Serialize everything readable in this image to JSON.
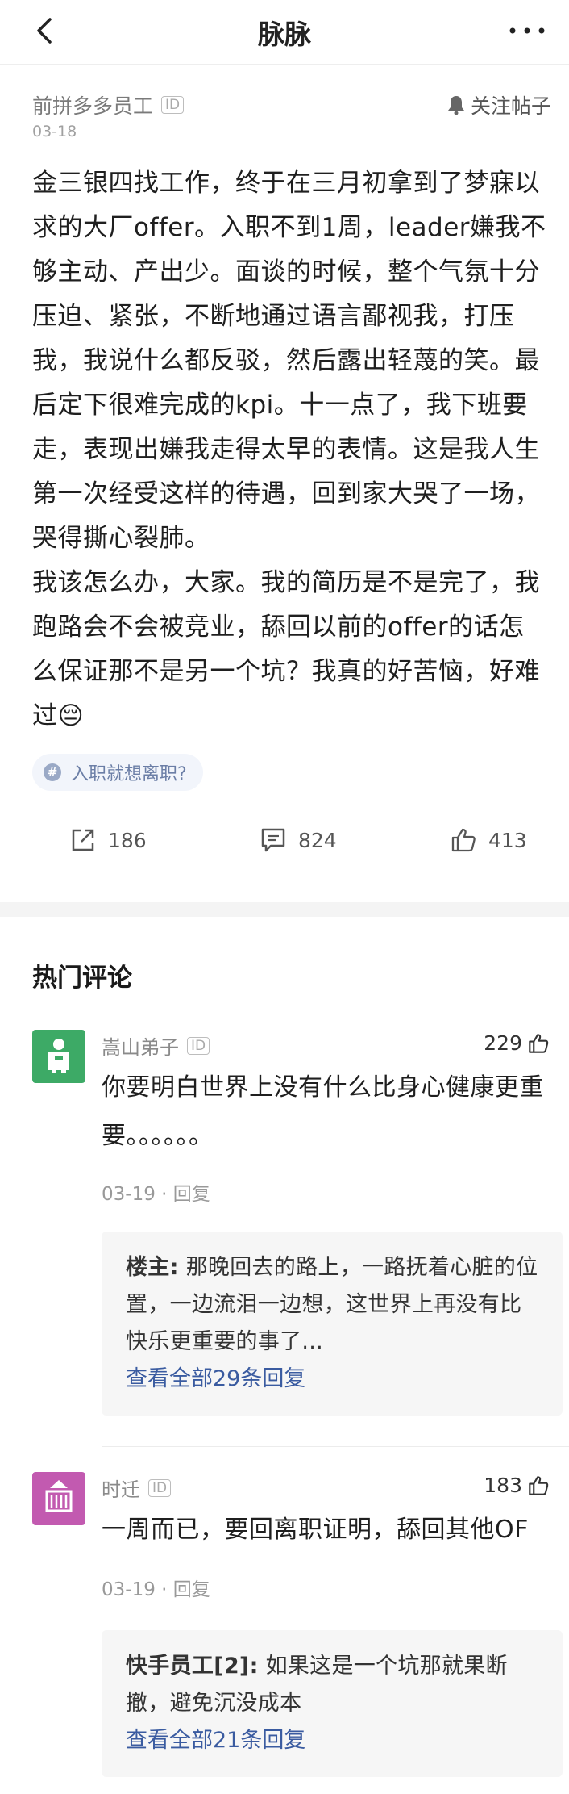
{
  "nav": {
    "title": "脉脉"
  },
  "post": {
    "author": "前拼多多员工",
    "id_badge": "ID",
    "date": "03-18",
    "follow_label": "关注帖子",
    "paragraph1": "金三银四找工作，终于在三月初拿到了梦寐以求的大厂offer。入职不到1周，leader嫌我不够主动、产出少。面谈的时候，整个气氛十分压迫、紧张，不断地通过语言鄙视我，打压我，我说什么都反驳，然后露出轻蔑的笑。最后定下很难完成的kpi。十一点了，我下班要走，表现出嫌我走得太早的表情。这是我人生第一次经受这样的待遇，回到家大哭了一场，哭得撕心裂肺。",
    "paragraph2": "我该怎么办，大家。我的简历是不是完了，我跑路会不会被竞业，舔回以前的offer的话怎么保证那不是另一个坑？我真的好苦恼，好难过😔",
    "tag": "入职就想离职?",
    "tag_symbol": "#",
    "shares": "186",
    "comments": "824",
    "likes": "413"
  },
  "hot_comments_title": "热门评论",
  "comments": [
    {
      "name": "嵩山弟子",
      "id_badge": "ID",
      "likes": "229",
      "text": "你要明白世界上没有什么比身心健康更重要。。。。。。",
      "meta": "03-19 · 回复",
      "avatar_color": "#3daa66",
      "reply_author": "楼主:",
      "reply_text": "那晚回去的路上，一路抚着心脏的位置，一边流泪一边想，这世界上再没有比快乐更重要的事了...",
      "reply_link": "查看全部29条回复"
    },
    {
      "name": "时迁",
      "id_badge": "ID",
      "likes": "183",
      "text": "一周而已，要回离职证明，舔回其他OF",
      "meta": "03-19 · 回复",
      "avatar_color": "#c25ab0",
      "reply_author": "快手员工[2]:",
      "reply_text": "如果这是一个坑那就果断撤，避免沉没成本",
      "reply_link": "查看全部21条回复"
    }
  ]
}
